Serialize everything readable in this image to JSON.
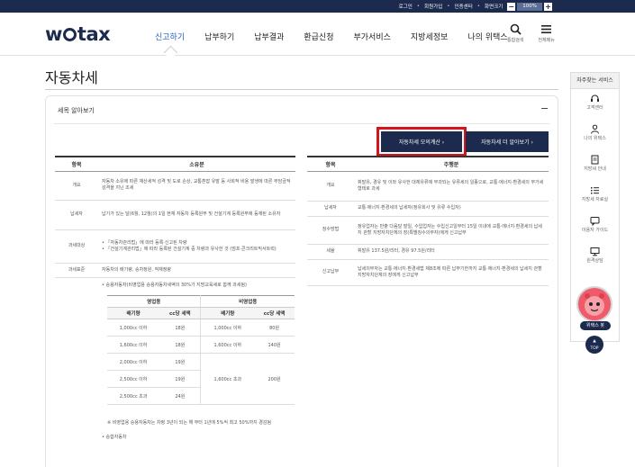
{
  "topbar": {
    "links": [
      "로그인",
      "회원가입",
      "인증센터",
      "화면크기"
    ],
    "zoom_minus": "−",
    "zoom_value": "100%",
    "zoom_plus": "+"
  },
  "header": {
    "logo": {
      "pre": "w",
      "post": "tax"
    },
    "nav": [
      "신고하기",
      "납부하기",
      "납부결과",
      "환급신청",
      "부가서비스",
      "지방세정보",
      "나의 위택스"
    ],
    "search_label": "통합검색",
    "menu_label": "전체메뉴"
  },
  "page_title": "자동차세",
  "card": {
    "title": "세목 알아보기",
    "collapse": "−",
    "btn_simulate": "자동차세 모의계산  ›",
    "btn_more": "자동차세 더 알아보기  ›"
  },
  "left_table": {
    "headers": [
      "항목",
      "소유분"
    ],
    "rows": [
      {
        "h": "개요",
        "v": "자동차 소유에 따른 재산세적 성격 및 도로 손상, 교통혼잡 유발 등 사회적 비용 발생에 따른 부담금적 성격을 지닌 조세"
      },
      {
        "h": "납세자",
        "v": "납기가 있는 달(6월, 12월)의 1일 현재 자동차 등록원부 및 건설기계 등록원부에 등재된 소유자"
      },
      {
        "h": "과세대상",
        "v1": "「자동차관리법」에 따라 등록·신고된 차량",
        "v2": "「건설기계관리법」에 따라 등록된 건설기계 중 차량과 유사한 것 (덤프·콘크리트믹서트럭)"
      },
      {
        "h": "과세표준",
        "v": "자동차의 배기량, 승차정원, 적재정량"
      }
    ],
    "rate_note": "승용자동차(비영업용 승용자동차세액의 30%가 지방교육세로 함께 과세됨)",
    "footnote": "※ 비영업용 승용자동차는 차령 3년이 되는 해 부터 1년에 5%씩 최고 50%까지 경감됨",
    "bullet2": "승합자동차"
  },
  "rate_table": {
    "groups": [
      "영업용",
      "비영업용"
    ],
    "cols": [
      "배기량",
      "cc당 세액",
      "배기량",
      "cc당 세액"
    ],
    "rows": [
      [
        "1,000cc 이하",
        "18원",
        "1,000cc 이하",
        "80원"
      ],
      [
        "1,600cc 이하",
        "18원",
        "1,600cc 이하",
        "140원"
      ],
      [
        "2,000cc 이하",
        "19원",
        "",
        ""
      ],
      [
        "2,500cc 이하",
        "19원",
        "1,600cc 초과",
        "200원"
      ],
      [
        "2,500cc 초과",
        "24원",
        "",
        ""
      ]
    ]
  },
  "right_table": {
    "headers": [
      "항목",
      "주행분"
    ],
    "rows": [
      {
        "h": "개요",
        "v": "휘발유, 경유 및 이와 유사한 대체유류에 부과되는 유류세의 일종으로, 교통·에너지·환경세의 부가세 형태로 과세"
      },
      {
        "h": "납세자",
        "v": "교통·에너지·환경세의 납세자(정유회사 및 유류 수입자)"
      },
      {
        "h": "징수방법",
        "v": "정유업자는 반출 다음달 말일, 수입업자는 수입신고일부터 15일 이내에 교통·에너지·환경세의 납세지 관할 지방자치단체의 장(특별징수의무자)에게 신고납부"
      },
      {
        "h": "세율",
        "v": "휘발유 137.5원/리터, 경유 97.5원/리터"
      },
      {
        "h": "신고납부",
        "v": "납세의무자는 교통·에너지·환경세법 제8조에 따른 납부기한까지 교통·에너지·환경세의 납세지 관할 지방자치단체의 장에게 신고납부"
      }
    ]
  },
  "sidebar": {
    "title": "자주찾는 서비스",
    "items": [
      "고객센터",
      "나의 위택스",
      "지방세 안내",
      "지방세 자료실",
      "이용자 가이드",
      "원격상담"
    ],
    "mascot_label": "위택스 봇",
    "top": "TOP"
  }
}
